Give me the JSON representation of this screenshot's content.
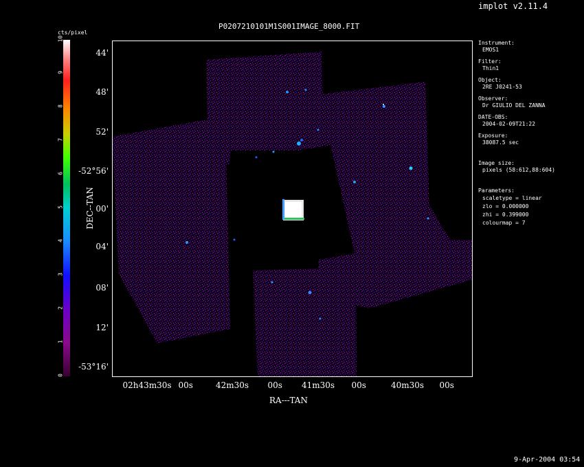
{
  "version_label": "implot v2.11.4",
  "plot_title": "P0207210101M1S001IMAGE_8000.FIT",
  "colorbar": {
    "unit": "cts/pixel",
    "ticks": [
      "0",
      "1",
      "2",
      "3",
      "4",
      "5",
      "6",
      "7",
      "8",
      "9",
      "10"
    ],
    "colors": [
      "#3a0030",
      "#8a0a8a",
      "#6a00c8",
      "#1010ff",
      "#1a8aff",
      "#00d0d0",
      "#00c060",
      "#40ff00",
      "#c8d000",
      "#ff8000",
      "#ff2020",
      "#ff8080",
      "#ffffff"
    ]
  },
  "axes": {
    "xlabel": "RA---TAN",
    "ylabel": "DEC--TAN",
    "x_ticks": [
      "02h43m30s",
      "00s",
      "42m30s",
      "00s",
      "41m30s",
      "00s",
      "40m30s",
      "00s"
    ],
    "y_ticks": [
      "44'",
      "48'",
      "52'",
      "-52°56'",
      "00'",
      "04'",
      "08'",
      "12'",
      "-53°16'"
    ]
  },
  "sidebar": {
    "instrument_label": "Instrument:",
    "instrument": "EMOS1",
    "filter_label": "Filter:",
    "filter": "Thin1",
    "object_label": "Object:",
    "object": "2RE J0241-53",
    "observer_label": "Observer:",
    "observer": "Dr GIULIO DEL ZANNA",
    "date_label": "DATE-OBS:",
    "date": "2004-02-09T21:22",
    "exposure_label": "Exposure:",
    "exposure": "38087.5 sec",
    "image_size_label": "Image size:",
    "image_size": "pixels (58:612,88:604)",
    "parameters_label": "Parameters:",
    "scaletype": "scaletype = linear",
    "zlo": "zlo = 0.000000",
    "zhi": "zhi = 0.399000",
    "colourmap": "colourmap =   7"
  },
  "footer_timestamp": "9-Apr-2004 03:54"
}
